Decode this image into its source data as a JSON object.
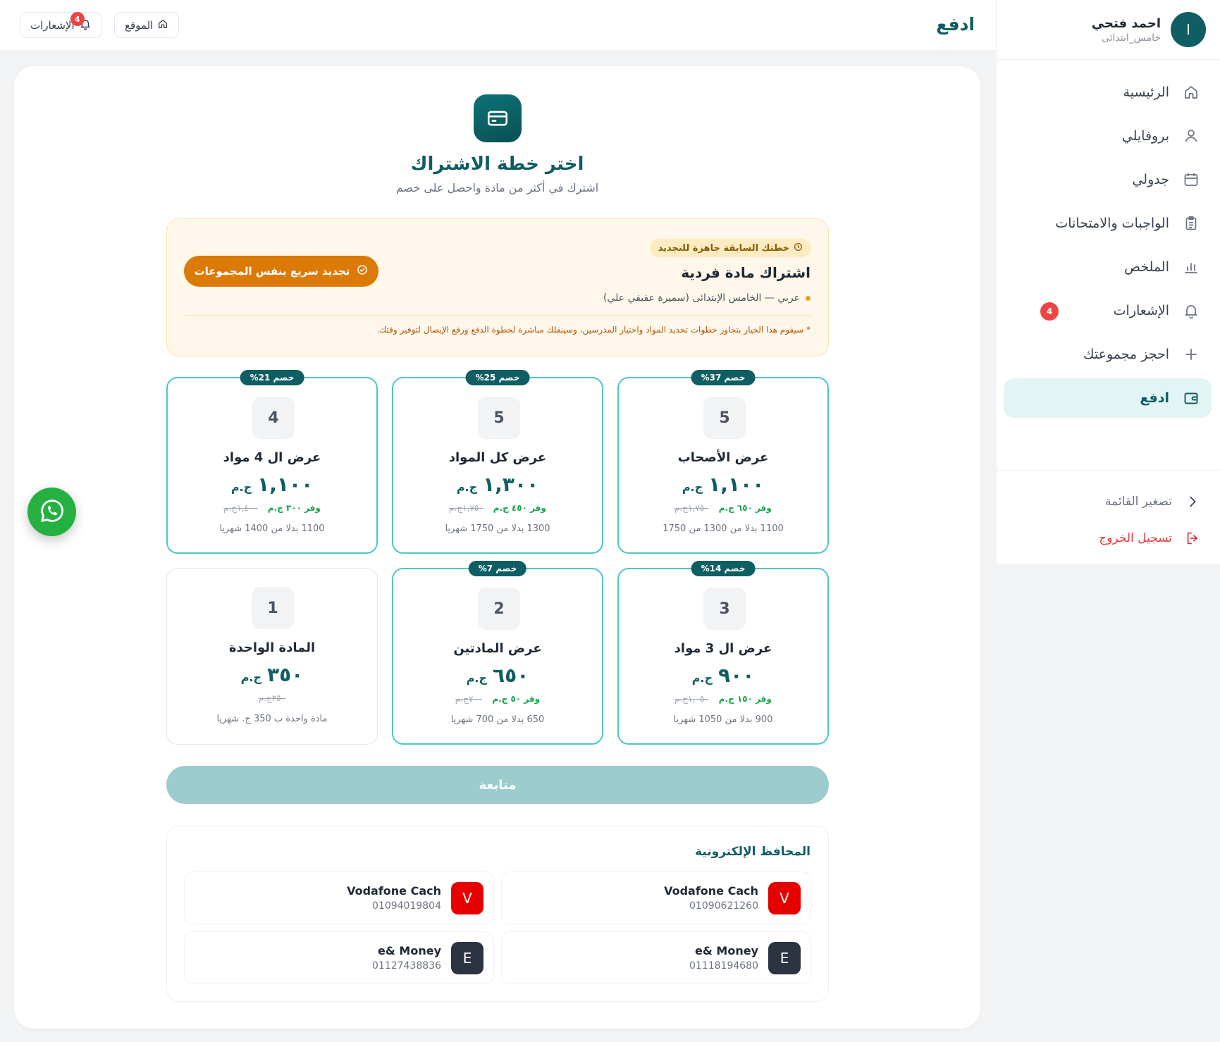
{
  "user": {
    "initial": "ا",
    "name": "احمد فتحي",
    "grade": "خامس_ابتدائى"
  },
  "sidebar": {
    "items": [
      {
        "label": "الرئيسية",
        "icon": "home-icon"
      },
      {
        "label": "بروفايلي",
        "icon": "user-icon"
      },
      {
        "label": "جدولي",
        "icon": "calendar-icon"
      },
      {
        "label": "الواجبات والامتحانات",
        "icon": "clipboard-icon"
      },
      {
        "label": "الملخص",
        "icon": "bar-chart-icon"
      },
      {
        "label": "الإشعارات",
        "icon": "bell-icon",
        "badge": "4"
      },
      {
        "label": "احجز مجموعتك",
        "icon": "plus-icon"
      },
      {
        "label": "ادفع",
        "icon": "wallet-icon",
        "active": true
      }
    ],
    "collapse_label": "تصغير القائمة",
    "logout_label": "تسجيل الخروج"
  },
  "topbar": {
    "page_title": "ادفع",
    "site_label": "الموقع",
    "notifications_label": "الإشعارات",
    "notifications_badge": "4"
  },
  "header": {
    "title": "اختر خطة الاشتراك",
    "subtitle": "اشترك في أكثر من مادة واحصل على خصم"
  },
  "renewal": {
    "tag": "خطتك السابقة جاهزة للتجديد",
    "title": "اشتراك مادة فردية",
    "info": "عربي — الخامس الإبتدائى (سميرة عفيفي علي)",
    "note": "* سيقوم هذا الخيار بتجاوز خطوات تحديد المواد واختيار المدرسين، وسينقلك مباشرة لخطوة الدفع ورفع الإيصال لتوفير وقتك.",
    "button": "تجديد سريع بنفس المجموعات"
  },
  "plans": [
    {
      "discount": "خصم 37%",
      "count": "5",
      "name": "عرض الأصحاب",
      "price": "١,١٠٠",
      "currency": "ج.م",
      "old_price": "١,٧٥٠ج.م",
      "save": "وفر ٦٥٠ ج.م",
      "detail": "1100 بدلا من 1300 من 1750"
    },
    {
      "discount": "خصم 25%",
      "count": "5",
      "name": "عرض كل المواد",
      "price": "١,٣٠٠",
      "currency": "ج.م",
      "old_price": "١,٧٥٠ج.م",
      "save": "وفر ٤٥٠ ج.م",
      "detail": "1300 بدلا من 1750 شهريا"
    },
    {
      "discount": "خصم 21%",
      "count": "4",
      "name": "عرض ال 4 مواد",
      "price": "١,١٠٠",
      "currency": "ج.م",
      "old_price": "١,٤٠٠ج.م",
      "save": "وفر ٣٠٠ ج.م",
      "detail": "1100 بدلا من 1400 شهريا"
    },
    {
      "discount": "خصم 14%",
      "count": "3",
      "name": "عرض ال 3 مواد",
      "price": "٩٠٠",
      "currency": "ج.م",
      "old_price": "١,٠٥٠ج.م",
      "save": "وفر ١٥٠ ج.م",
      "detail": "900 بدلا من 1050 شهريا"
    },
    {
      "discount": "خصم 7%",
      "count": "2",
      "name": "عرض المادتين",
      "price": "٦٥٠",
      "currency": "ج.م",
      "old_price": "٧٠٠ج.م",
      "save": "وفر ٥٠ ج.م",
      "detail": "650 بدلا من 700 شهريا"
    },
    {
      "discount": "",
      "count": "1",
      "name": "المادة الواحدة",
      "price": "٣٥٠",
      "currency": "ج.م",
      "old_price": "٣٥٠ج.م",
      "save": "",
      "detail": "مادة واحدة ب 350 ج. شهريا"
    }
  ],
  "continue_label": "متابعة",
  "wallets": {
    "title": "المحافظ الإلكترونية",
    "items": [
      {
        "logo": "V",
        "name": "Vodafone Cach",
        "number": "01090621260"
      },
      {
        "logo": "V",
        "name": "Vodafone Cach",
        "number": "01094019804"
      },
      {
        "logo": "E",
        "name": "e& Money",
        "number": "01118194680"
      },
      {
        "logo": "E",
        "name": "e& Money",
        "number": "01127438836"
      }
    ]
  },
  "colors": {
    "brand": "#0f5e63",
    "accent": "#db7a07",
    "plan_border": "#4fc6c6",
    "whatsapp": "#25b142"
  }
}
